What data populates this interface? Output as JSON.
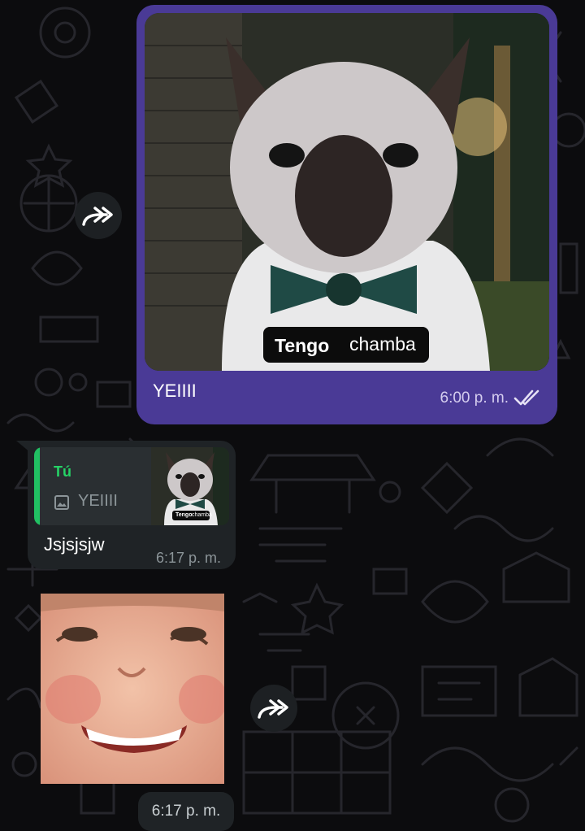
{
  "messages": {
    "outgoing": {
      "meme_caption_1": "Tengo",
      "meme_caption_2": "chamba",
      "caption": "YEIIII",
      "time": "6:00 p. m.",
      "status_icon": "double-check-icon"
    },
    "reply": {
      "quote_author": "Tú",
      "quote_text": "YEIIII",
      "thumb_caption_1": "Tengo",
      "thumb_caption_2": "chamba",
      "text": "Jsjsjsjw",
      "time": "6:17 p. m."
    },
    "sticker": {
      "time": "6:17 p. m."
    }
  },
  "icons": {
    "forward": "forward-icon",
    "photo": "photo-icon"
  },
  "colors": {
    "outgoing_bubble": "#4a3a96",
    "incoming_bubble": "#1f2326",
    "quote_accent": "#21c063",
    "background": "#0c0c0e"
  }
}
